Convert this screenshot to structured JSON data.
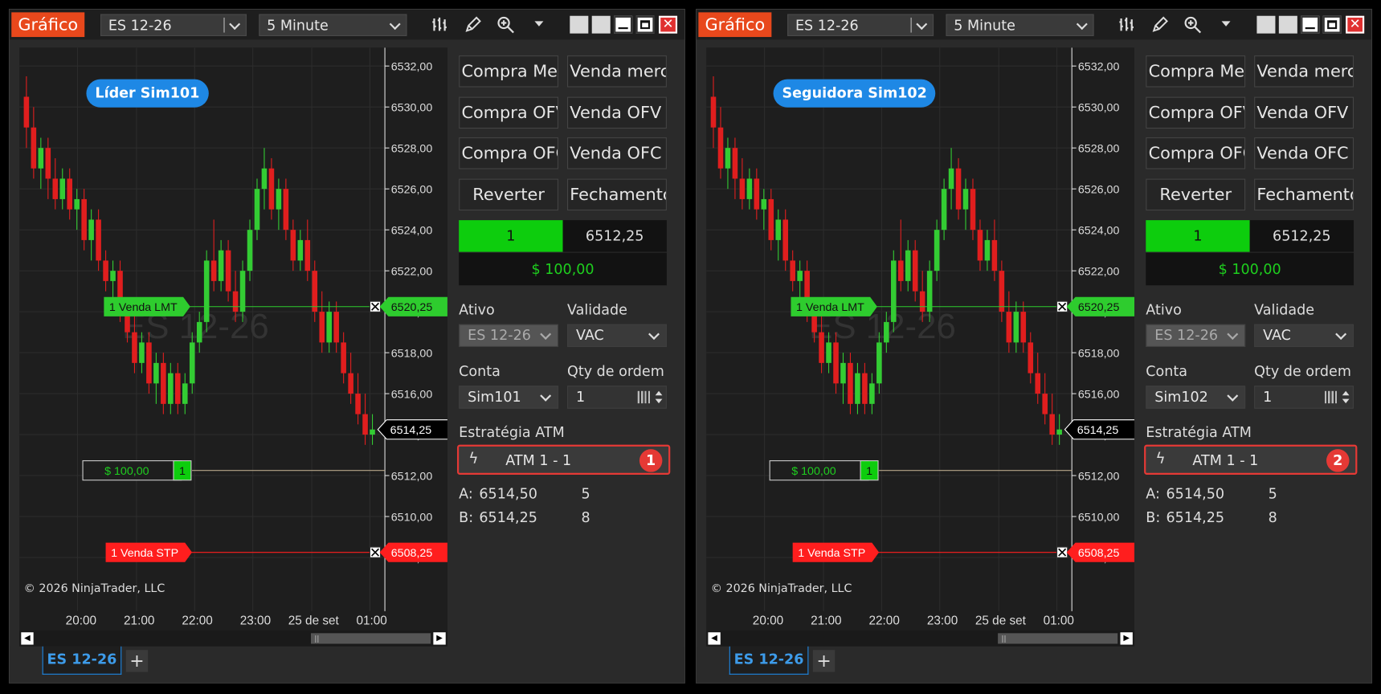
{
  "colors": {
    "accent_title": "#e8481c",
    "buy": "#0dcd0d",
    "sell": "#ff1e1e",
    "neutral": "#1e88e5",
    "atm_border": "#e53935",
    "up_candle": "#33cc33",
    "down_candle": "#e01e1e"
  },
  "windows": [
    {
      "title": "Gráfico",
      "instrument": "ES 12-26",
      "period": "5 Minute",
      "tools": {
        "bars": "bar-chart-icon",
        "pencil": "pencil-icon",
        "zoom": "zoom-icon",
        "more": "chevron-down-icon"
      },
      "account_badge": "Líder Sim101",
      "copyright": "© 2026 NinjaTrader, LLC",
      "chart": {
        "price_labels": [
          "6532,00",
          "6530,00",
          "6528,00",
          "6526,00",
          "6524,00",
          "6522,00",
          "6520,00",
          "6518,00",
          "6516,00",
          "6514,00",
          "6512,00",
          "6510,00",
          "6508,00"
        ],
        "time_labels": [
          "20:00",
          "21:00",
          "22:00",
          "23:00",
          "25 de set",
          "01:00"
        ],
        "last_price": "6514,25",
        "lmt_order": {
          "label": "1 Venda LMT",
          "price": "6520,25",
          "value": 6520.25
        },
        "stp_order": {
          "label": "1 Venda STP",
          "price": "6508,25",
          "value": 6508.25
        },
        "position": {
          "pnl": "$ 100,00",
          "qty": "1",
          "value": 6512.25
        },
        "watermark": "ES 12-26"
      },
      "buttons": [
        [
          "Compra Mercado",
          "Venda mercado"
        ],
        [
          "Compra OFV",
          "Venda OFV"
        ],
        [
          "Compra OFC",
          "Venda OFC"
        ],
        [
          "Reverter",
          "Fechamento"
        ]
      ],
      "position_qty": "1",
      "position_price": "6512,25",
      "position_pnl": "$ 100,00",
      "labels": {
        "ativo": "Ativo",
        "validade": "Validade",
        "conta": "Conta",
        "qty": "Qty de ordem",
        "atm": "Estratégia ATM"
      },
      "ativo_value": "ES 12-26",
      "validade_value": "VAC",
      "conta_value": "Sim101",
      "qty_value": "1",
      "atm_name": "ATM 1 - 1",
      "atm_badge": "1",
      "ask": {
        "label": "A:",
        "price": "6514,50",
        "size": "5"
      },
      "bid": {
        "label": "B:",
        "price": "6514,25",
        "size": "8"
      },
      "tab": "ES 12-26",
      "add_tab": "+"
    },
    {
      "title": "Gráfico",
      "instrument": "ES 12-26",
      "period": "5 Minute",
      "tools": {
        "bars": "bar-chart-icon",
        "pencil": "pencil-icon",
        "zoom": "zoom-icon",
        "more": "chevron-down-icon"
      },
      "account_badge": "Seguidora Sim102",
      "copyright": "© 2026 NinjaTrader, LLC",
      "chart": {
        "price_labels": [
          "6532,00",
          "6530,00",
          "6528,00",
          "6526,00",
          "6524,00",
          "6522,00",
          "6520,00",
          "6518,00",
          "6516,00",
          "6514,00",
          "6512,00",
          "6510,00",
          "6508,00"
        ],
        "time_labels": [
          "20:00",
          "21:00",
          "22:00",
          "23:00",
          "25 de set",
          "01:00"
        ],
        "last_price": "6514,25",
        "lmt_order": {
          "label": "1 Venda LMT",
          "price": "6520,25",
          "value": 6520.25
        },
        "stp_order": {
          "label": "1 Venda STP",
          "price": "6508,25",
          "value": 6508.25
        },
        "position": {
          "pnl": "$ 100,00",
          "qty": "1",
          "value": 6512.25
        },
        "watermark": "ES 12-26"
      },
      "buttons": [
        [
          "Compra Mercado",
          "Venda mercado"
        ],
        [
          "Compra OFV",
          "Venda OFV"
        ],
        [
          "Compra OFC",
          "Venda OFC"
        ],
        [
          "Reverter",
          "Fechamento"
        ]
      ],
      "position_qty": "1",
      "position_price": "6512,25",
      "position_pnl": "$ 100,00",
      "labels": {
        "ativo": "Ativo",
        "validade": "Validade",
        "conta": "Conta",
        "qty": "Qty de ordem",
        "atm": "Estratégia ATM"
      },
      "ativo_value": "ES 12-26",
      "validade_value": "VAC",
      "conta_value": "Sim102",
      "qty_value": "1",
      "atm_name": "ATM 1 - 1",
      "atm_badge": "2",
      "ask": {
        "label": "A:",
        "price": "6514,50",
        "size": "5"
      },
      "bid": {
        "label": "B:",
        "price": "6514,25",
        "size": "8"
      },
      "tab": "ES 12-26",
      "add_tab": "+"
    }
  ],
  "chart_data": {
    "type": "candlestick",
    "price_axis": [
      6508,
      6532
    ],
    "candles": [
      {
        "o": 6530.5,
        "h": 6531.5,
        "l": 6528.0,
        "c": 6529.0
      },
      {
        "o": 6529.0,
        "h": 6530.0,
        "l": 6526.5,
        "c": 6527.0
      },
      {
        "o": 6527.0,
        "h": 6528.5,
        "l": 6526.0,
        "c": 6528.0
      },
      {
        "o": 6528.0,
        "h": 6528.5,
        "l": 6525.5,
        "c": 6526.5
      },
      {
        "o": 6526.5,
        "h": 6527.5,
        "l": 6525.0,
        "c": 6525.5
      },
      {
        "o": 6525.5,
        "h": 6527.0,
        "l": 6525.0,
        "c": 6526.5
      },
      {
        "o": 6526.5,
        "h": 6527.0,
        "l": 6524.5,
        "c": 6525.0
      },
      {
        "o": 6525.0,
        "h": 6526.0,
        "l": 6524.0,
        "c": 6525.5
      },
      {
        "o": 6525.5,
        "h": 6526.0,
        "l": 6523.0,
        "c": 6523.5
      },
      {
        "o": 6523.5,
        "h": 6525.0,
        "l": 6522.5,
        "c": 6524.5
      },
      {
        "o": 6524.5,
        "h": 6525.0,
        "l": 6522.0,
        "c": 6522.5
      },
      {
        "o": 6522.5,
        "h": 6523.0,
        "l": 6521.0,
        "c": 6521.5
      },
      {
        "o": 6521.5,
        "h": 6522.5,
        "l": 6520.0,
        "c": 6522.0
      },
      {
        "o": 6522.0,
        "h": 6522.5,
        "l": 6519.5,
        "c": 6520.0
      },
      {
        "o": 6520.0,
        "h": 6520.5,
        "l": 6518.5,
        "c": 6519.0
      },
      {
        "o": 6519.0,
        "h": 6520.0,
        "l": 6517.0,
        "c": 6517.5
      },
      {
        "o": 6517.5,
        "h": 6519.0,
        "l": 6517.0,
        "c": 6518.5
      },
      {
        "o": 6518.5,
        "h": 6519.0,
        "l": 6516.0,
        "c": 6516.5
      },
      {
        "o": 6516.5,
        "h": 6518.0,
        "l": 6515.5,
        "c": 6517.5
      },
      {
        "o": 6517.5,
        "h": 6518.0,
        "l": 6515.0,
        "c": 6515.5
      },
      {
        "o": 6515.5,
        "h": 6517.5,
        "l": 6515.0,
        "c": 6517.0
      },
      {
        "o": 6517.0,
        "h": 6517.5,
        "l": 6515.0,
        "c": 6515.5
      },
      {
        "o": 6515.5,
        "h": 6517.0,
        "l": 6515.0,
        "c": 6516.5
      },
      {
        "o": 6516.5,
        "h": 6519.0,
        "l": 6516.0,
        "c": 6518.5
      },
      {
        "o": 6518.5,
        "h": 6520.0,
        "l": 6518.0,
        "c": 6519.5
      },
      {
        "o": 6519.5,
        "h": 6523.0,
        "l": 6519.0,
        "c": 6522.5
      },
      {
        "o": 6522.5,
        "h": 6524.5,
        "l": 6521.0,
        "c": 6521.5
      },
      {
        "o": 6521.5,
        "h": 6523.5,
        "l": 6521.0,
        "c": 6523.0
      },
      {
        "o": 6523.0,
        "h": 6523.5,
        "l": 6520.5,
        "c": 6521.0
      },
      {
        "o": 6521.0,
        "h": 6522.0,
        "l": 6519.5,
        "c": 6520.0
      },
      {
        "o": 6520.0,
        "h": 6522.5,
        "l": 6519.5,
        "c": 6522.0
      },
      {
        "o": 6522.0,
        "h": 6524.5,
        "l": 6521.5,
        "c": 6524.0
      },
      {
        "o": 6524.0,
        "h": 6526.5,
        "l": 6523.5,
        "c": 6526.0
      },
      {
        "o": 6526.0,
        "h": 6528.0,
        "l": 6525.0,
        "c": 6527.0
      },
      {
        "o": 6527.0,
        "h": 6527.5,
        "l": 6524.5,
        "c": 6525.0
      },
      {
        "o": 6525.0,
        "h": 6526.5,
        "l": 6524.0,
        "c": 6526.0
      },
      {
        "o": 6526.0,
        "h": 6526.5,
        "l": 6523.5,
        "c": 6524.0
      },
      {
        "o": 6524.0,
        "h": 6524.5,
        "l": 6522.0,
        "c": 6522.5
      },
      {
        "o": 6522.5,
        "h": 6524.0,
        "l": 6522.0,
        "c": 6523.5
      },
      {
        "o": 6523.5,
        "h": 6524.5,
        "l": 6521.5,
        "c": 6522.0
      },
      {
        "o": 6522.0,
        "h": 6522.5,
        "l": 6519.5,
        "c": 6520.0
      },
      {
        "o": 6520.0,
        "h": 6521.0,
        "l": 6518.0,
        "c": 6518.5
      },
      {
        "o": 6518.5,
        "h": 6520.5,
        "l": 6518.0,
        "c": 6520.0
      },
      {
        "o": 6520.0,
        "h": 6520.5,
        "l": 6518.0,
        "c": 6518.5
      },
      {
        "o": 6518.5,
        "h": 6519.0,
        "l": 6516.5,
        "c": 6517.0
      },
      {
        "o": 6517.0,
        "h": 6518.0,
        "l": 6515.5,
        "c": 6516.0
      },
      {
        "o": 6516.0,
        "h": 6517.0,
        "l": 6514.5,
        "c": 6515.0
      },
      {
        "o": 6515.0,
        "h": 6516.0,
        "l": 6513.5,
        "c": 6514.0
      },
      {
        "o": 6514.0,
        "h": 6515.0,
        "l": 6513.5,
        "c": 6514.25
      }
    ]
  }
}
